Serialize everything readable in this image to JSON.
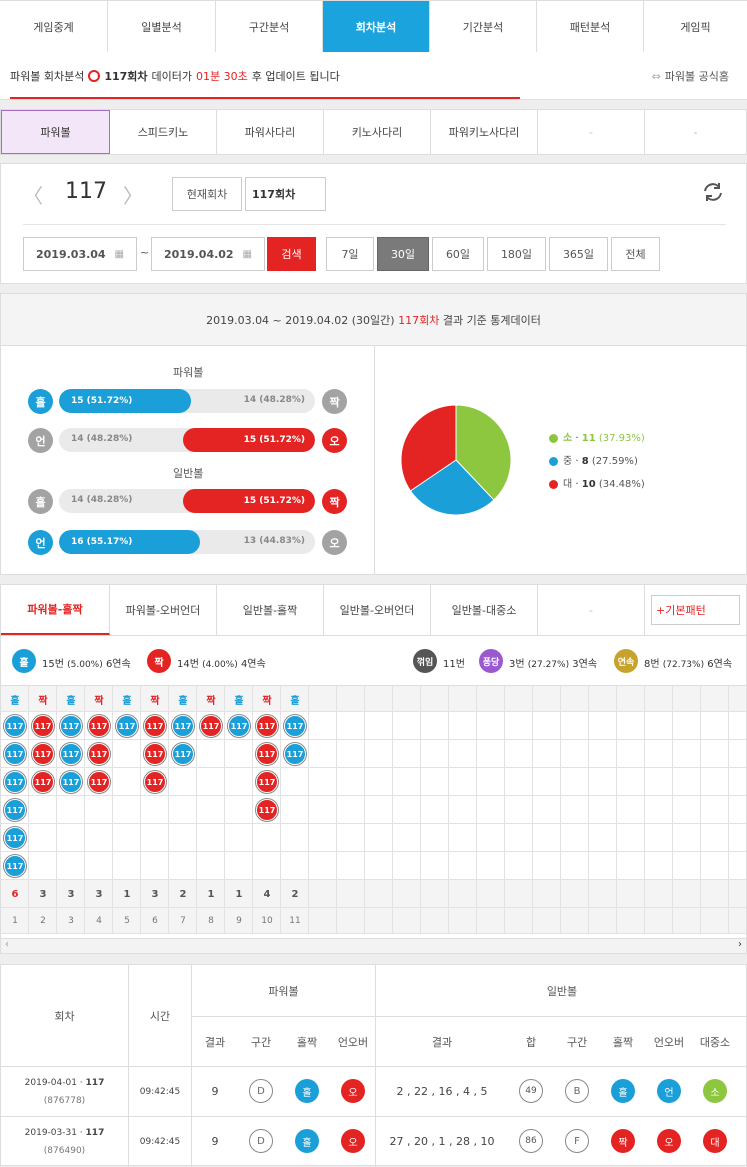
{
  "top_tabs": [
    "게임중계",
    "일별분석",
    "구간분석",
    "회차분석",
    "기간분석",
    "패턴분석",
    "게임픽"
  ],
  "update": {
    "prefix": "파워볼 회차분석",
    "round": "117회차",
    "mid": "데이터가",
    "time": "01분 30초",
    "suffix": "후 업데이트 됩니다",
    "link": "파워볼 공식홈"
  },
  "game_tabs": [
    "파워볼",
    "스피드키노",
    "파워사다리",
    "키노사다리",
    "파워키노사다리",
    "-",
    "-"
  ],
  "round_nav": {
    "number": "117",
    "current_btn": "현재회차",
    "round_value": "117회차",
    "prev": "〈",
    "next": "〉"
  },
  "date_filter": {
    "from": "2019.03.04",
    "sep": "~",
    "to": "2019.04.02",
    "search": "검색",
    "ranges": [
      "7일",
      "30일",
      "60일",
      "180일",
      "365일",
      "전체"
    ]
  },
  "stats": {
    "header_a": "2019.03.04 ~ 2019.04.02 (30일간)",
    "header_round": "117회차",
    "header_b": "결과 기준 통계데이터",
    "pb_title": "파워볼",
    "nb_title": "일반볼",
    "rows": [
      {
        "l": "홀",
        "lv": "15 (51.72%)",
        "rv": "14 (48.28%)",
        "r": "짝"
      },
      {
        "l": "언",
        "lv": "14 (48.28%)",
        "rv": "15 (51.72%)",
        "r": "오"
      },
      {
        "l": "홀",
        "lv": "14 (48.28%)",
        "rv": "15 (51.72%)",
        "r": "짝"
      },
      {
        "l": "언",
        "lv": "16 (55.17%)",
        "rv": "13 (44.83%)",
        "r": "오"
      }
    ],
    "legend": [
      {
        "label": "소",
        "count": "11",
        "pct": "(37.93%)",
        "color": "#8dc63f"
      },
      {
        "label": "중",
        "count": "8",
        "pct": "(27.59%)",
        "color": "#1a9fd8"
      },
      {
        "label": "대",
        "count": "10",
        "pct": "(34.48%)",
        "color": "#e42323"
      }
    ]
  },
  "chart_data": {
    "type": "pie",
    "categories": [
      "소",
      "중",
      "대"
    ],
    "values": [
      11,
      8,
      10
    ],
    "colors": [
      "#8dc63f",
      "#1a9fd8",
      "#e42323"
    ]
  },
  "pattern_tabs": [
    "파워볼-홀짝",
    "파워볼-오버언더",
    "일반볼-홀짝",
    "일반볼-오버언더",
    "일반볼-대중소",
    "-"
  ],
  "add_pattern": "+기본패턴",
  "pattern_summary": {
    "odd_icon": "홀",
    "odd_text": "15번",
    "odd_pct": "(5.00%)",
    "odd_streak": "6연속",
    "even_icon": "짝",
    "even_text": "14번",
    "even_pct": "(4.00%)",
    "even_streak": "4연속",
    "alt_icon": "꺾임",
    "alt_text": "11번",
    "pong_icon": "퐁당",
    "pong_text": "3번",
    "pong_pct": "(27.27%)",
    "pong_streak": "3연속",
    "cont_icon": "연속",
    "cont_text": "8번",
    "cont_pct": "(72.73%)",
    "cont_streak": "6연속"
  },
  "pattern_grid": {
    "headers": [
      "홀",
      "짝",
      "홀",
      "짝",
      "홀",
      "짝",
      "홀",
      "짝",
      "홀",
      "짝",
      "홀"
    ],
    "ball_label": "117",
    "counts": [
      "6",
      "3",
      "3",
      "3",
      "1",
      "3",
      "2",
      "1",
      "1",
      "4",
      "2"
    ],
    "indexes": [
      "1",
      "2",
      "3",
      "4",
      "5",
      "6",
      "7",
      "8",
      "9",
      "10",
      "11"
    ]
  },
  "table": {
    "h_round": "회차",
    "h_time": "시간",
    "h_pb": "파워볼",
    "h_nb": "일반볼",
    "sub": [
      "결과",
      "구간",
      "홀짝",
      "언오버",
      "결과",
      "합",
      "구간",
      "홀짝",
      "언오버",
      "대중소"
    ],
    "rows": [
      {
        "date": "2019-04-01 ·",
        "round": "117",
        "id": "(876778)",
        "time": "09:42:45",
        "pb": "9",
        "pb_range": "D",
        "pb_oe": "홀",
        "pb_uo": "오",
        "nb": "2 , 22 , 16 , 4 , 5",
        "sum": "49",
        "range": "B",
        "oe": "홀",
        "uo": "언",
        "size": "소"
      },
      {
        "date": "2019-03-31 ·",
        "round": "117",
        "id": "(876490)",
        "time": "09:42:45",
        "pb": "9",
        "pb_range": "D",
        "pb_oe": "홀",
        "pb_uo": "오",
        "nb": "27 , 20 , 1 , 28 , 10",
        "sum": "86",
        "range": "F",
        "oe": "짝",
        "uo": "오",
        "size": "대"
      }
    ]
  }
}
